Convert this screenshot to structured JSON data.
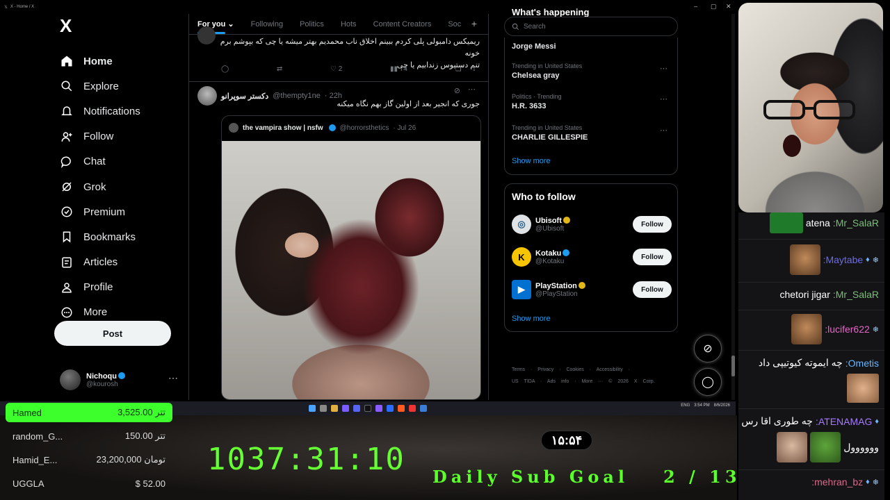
{
  "browser": {
    "tab_title": "X - Home / X",
    "controls": [
      "–",
      "▢",
      "✕"
    ]
  },
  "sidebar": {
    "logo": "X",
    "items": [
      {
        "label": "Home",
        "icon": "home-icon",
        "glyph": "⌂"
      },
      {
        "label": "Explore",
        "icon": "search-icon",
        "glyph": "⌕"
      },
      {
        "label": "Notifications",
        "icon": "bell-icon",
        "glyph": "🔔"
      },
      {
        "label": "Follow",
        "icon": "add-person-icon",
        "glyph": "✚"
      },
      {
        "label": "Chat",
        "icon": "chat-bubble-icon",
        "glyph": "◯"
      },
      {
        "label": "Grok",
        "icon": "grok-icon",
        "glyph": "⊘"
      },
      {
        "label": "Premium",
        "icon": "verified-icon",
        "glyph": "✔"
      },
      {
        "label": "Bookmarks",
        "icon": "bookmark-icon",
        "glyph": "❏"
      },
      {
        "label": "Articles",
        "icon": "article-icon",
        "glyph": "☰"
      },
      {
        "label": "Profile",
        "icon": "person-icon",
        "glyph": "☺"
      },
      {
        "label": "More",
        "icon": "more-circle-icon",
        "glyph": "⋯"
      }
    ],
    "post_label": "Post",
    "account": {
      "name": "Nichoqu",
      "handle": "@kourosh",
      "more": "⋯"
    }
  },
  "feed": {
    "tabs": [
      "For you",
      "Following",
      "Politics",
      "Hots",
      "Content Creators",
      "Soc"
    ],
    "add_tab": "+",
    "tweet1": {
      "text_line1": "ریمیکس دامبولی پلی کردم ببینم اخلاق ناب محمدیم بهتر میشه یا چی که بپوشم برم خونه",
      "text_line2": "تنم دستیوس زندابیم یا چی",
      "likes": "2",
      "views": "74"
    },
    "tweet2": {
      "author": "دکستر سوپرانو",
      "handle": "@thempty1ne",
      "time": "· 22h",
      "text": "جوری که انجیر بعد از اولین گاز بهم نگاه میکنه",
      "quote_author": "the vampira show | nsfw",
      "quote_handle": "@horrorsthetics",
      "quote_time": "· Jul 26"
    }
  },
  "right": {
    "whats_happening": "What's happening",
    "search_placeholder": "Search",
    "trends": [
      {
        "meta": "",
        "name": "Jorge Messi"
      },
      {
        "meta": "Trending in United States",
        "name": "Chelsea gray"
      },
      {
        "meta": "Politics · Trending",
        "name": "H.R. 3633"
      },
      {
        "meta": "Trending in United States",
        "name": "CHARLIE GILLESPIE"
      }
    ],
    "show_more": "Show more",
    "who_to_follow": "Who to follow",
    "follow_suggestions": [
      {
        "name": "Ubisoft",
        "handle": "@Ubisoft",
        "badge": "#e2b719",
        "logo": "◎",
        "logo_bg": "#dfe3e6",
        "logo_fg": "#2a5f88"
      },
      {
        "name": "Kotaku",
        "handle": "@Kotaku",
        "badge": "#1d9bf0",
        "logo": "K",
        "logo_bg": "#f7c500",
        "logo_fg": "#000000"
      },
      {
        "name": "PlayStation",
        "handle": "@PlayStation",
        "badge": "#e2b719",
        "logo": "▶",
        "logo_bg": "#0070d1",
        "logo_fg": "#ffffff"
      }
    ],
    "follow_label": "Follow",
    "show_more_2": "Show more",
    "footer_line1": "Terms · Privacy · Cookies · Accessibility ·",
    "footer_line2": "US TIDA · Ads info · More ··· © 2026 X Corp."
  },
  "taskbar": {
    "tray": [
      "ENG",
      "3:54 PM",
      "8/6/2026"
    ]
  },
  "stream": {
    "donations": [
      {
        "name": "Hamed",
        "amount": "3,525.00 تتر"
      },
      {
        "name": "random_G...",
        "amount": "150.00 تتر"
      },
      {
        "name": "Hamid_E...",
        "amount": "23,200,000 تومان"
      },
      {
        "name": "UGGLA",
        "amount": "$ 52.00"
      }
    ],
    "timer": "1037:31:10",
    "clock": "۱۵:۵۴",
    "sub_goal_label": "Daily Sub Goal",
    "sub_goal_count": "2 / 13",
    "accent": "#5bff2a"
  },
  "chat": {
    "messages": [
      {
        "user": "Mr_SalaR:",
        "text": "atena",
        "user_color": "#7dbd7a"
      },
      {
        "user": "Maytabe:",
        "text": "",
        "user_color": "#6b6be8"
      },
      {
        "user": "Mr_SalaR:",
        "text": "chetori jigar",
        "user_color": "#7dbd7a"
      },
      {
        "user": "lucifer622:",
        "text": "",
        "user_color": "#e667c8"
      },
      {
        "user": "Ometis:",
        "text": "چه ایموته کیوتیپی داد",
        "user_color": "#6ab7ff"
      },
      {
        "user": "ATENAMAG:",
        "text": "چه طوری اقا رس",
        "user_color": "#a57bff"
      },
      {
        "user": "",
        "text": "وووووول",
        "user_color": "#ffffff"
      },
      {
        "user": "mehran_bz:",
        "text": "",
        "user_color": "#d86a8a"
      }
    ]
  }
}
